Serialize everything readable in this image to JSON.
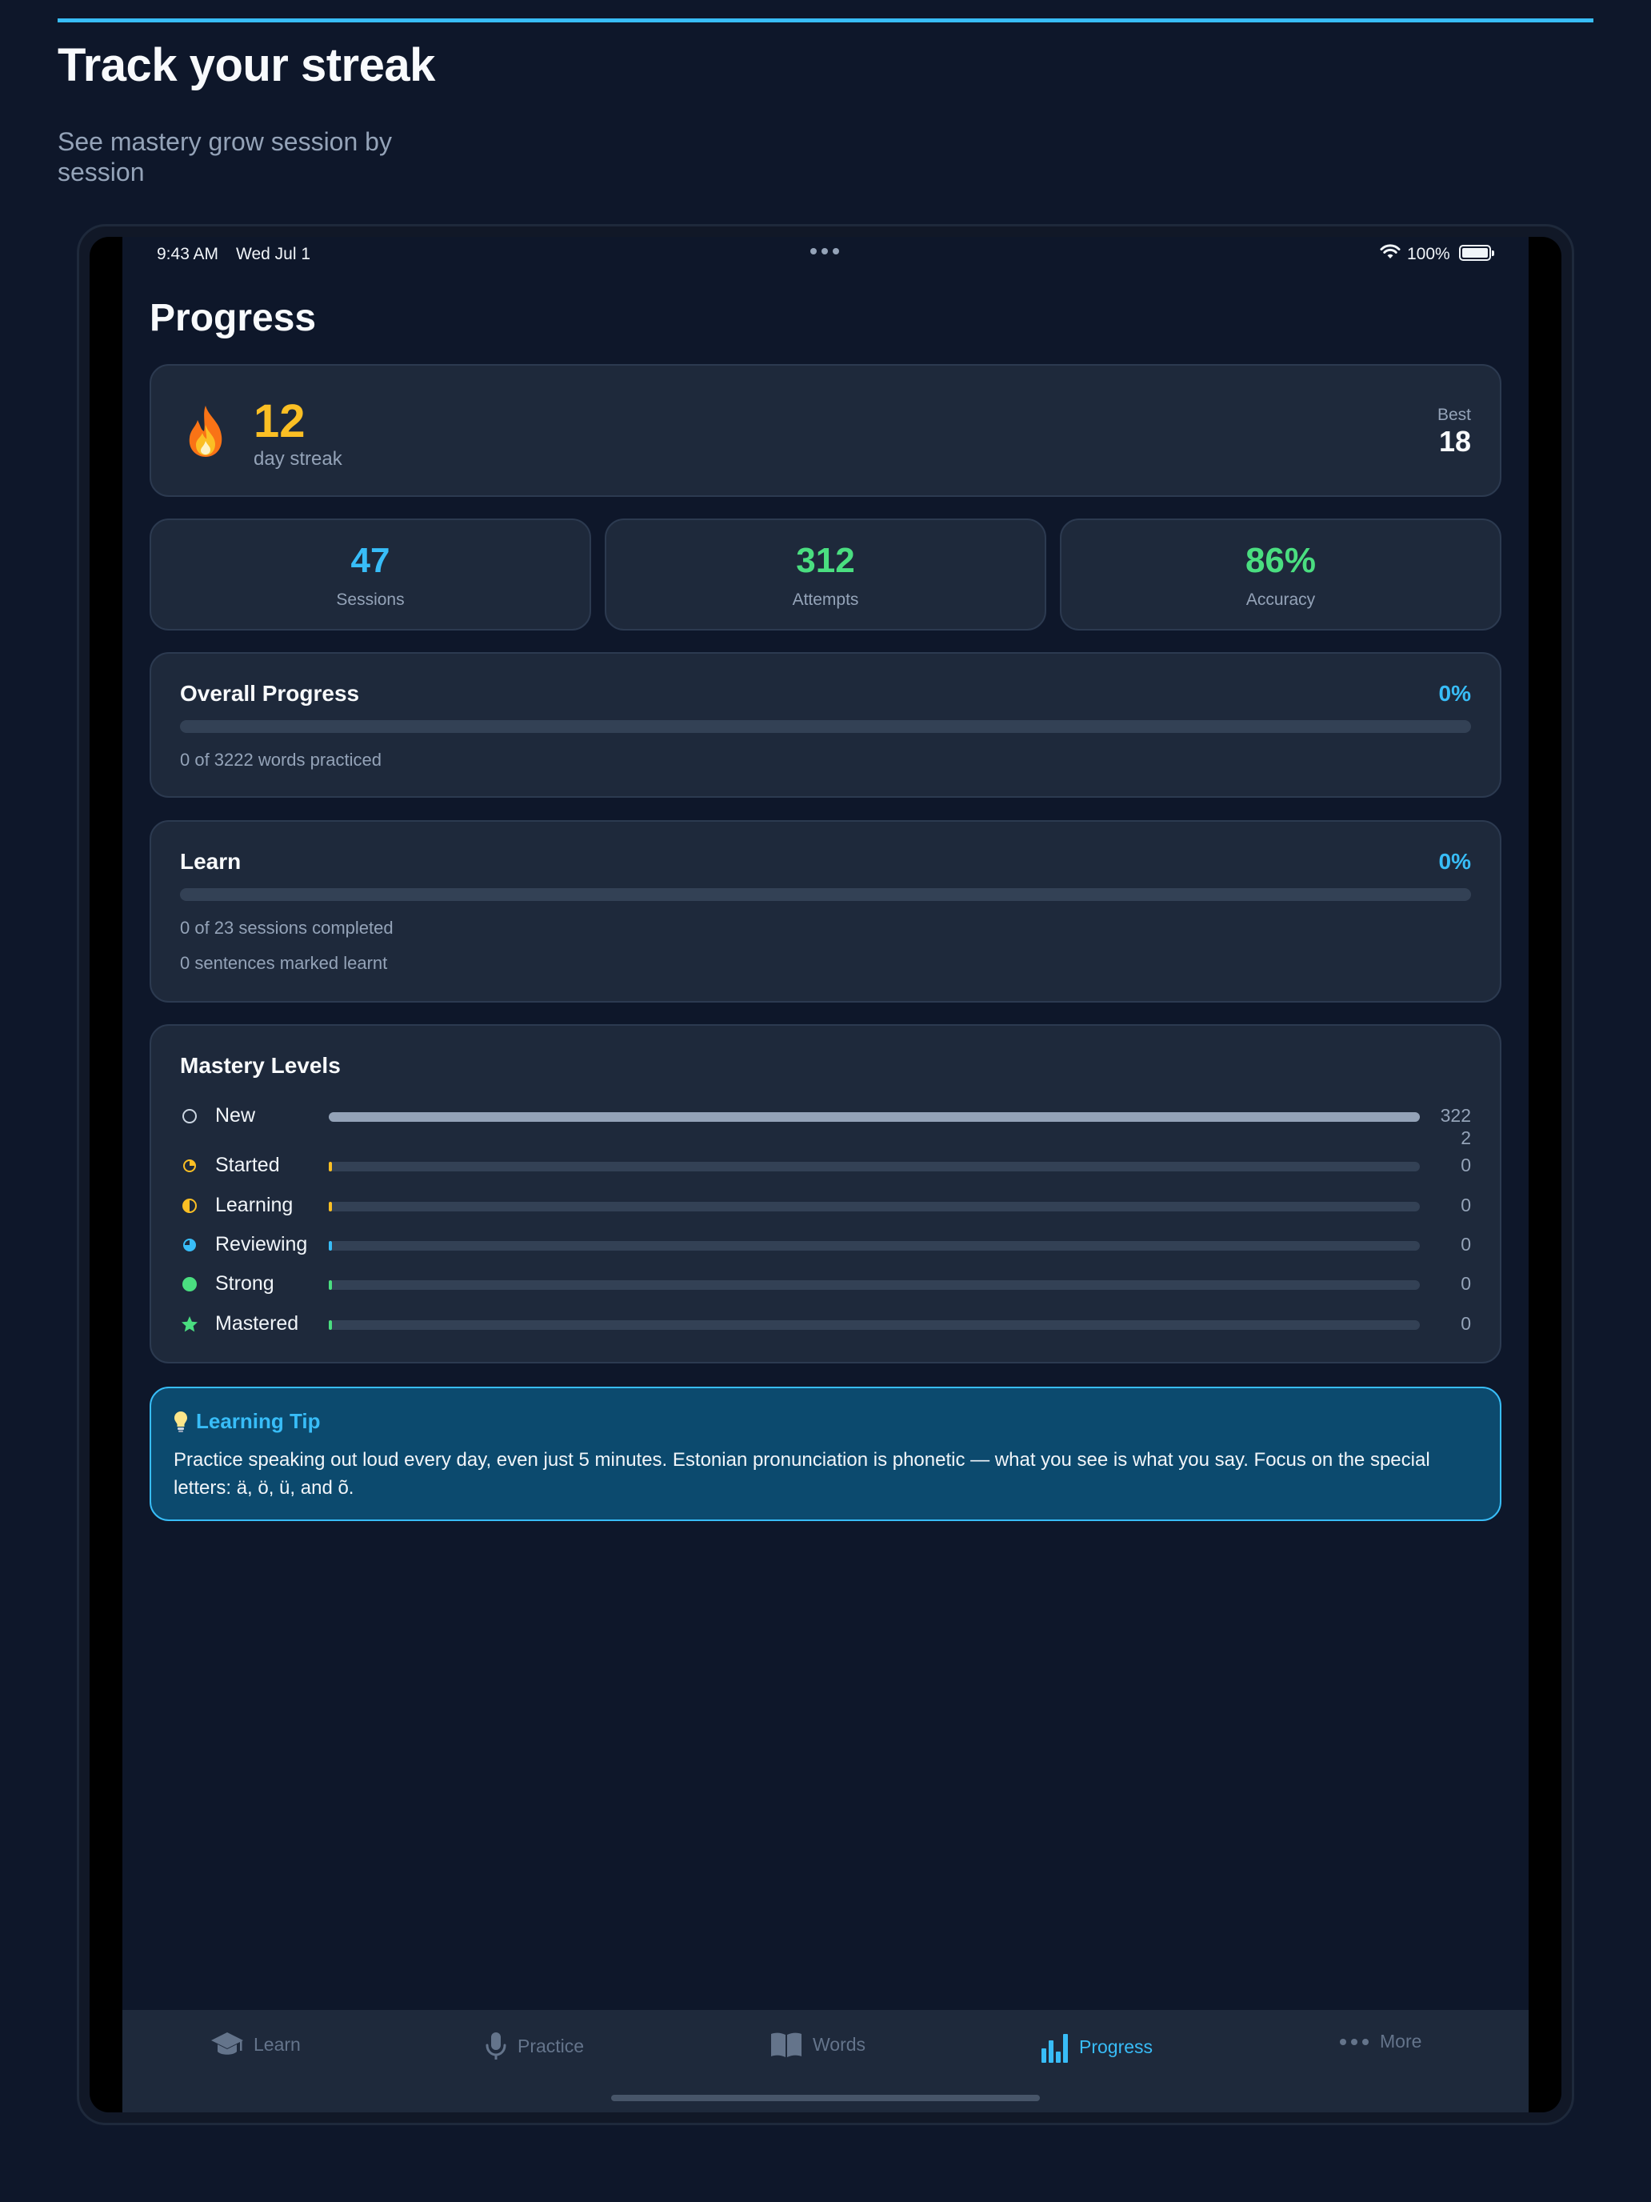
{
  "hero": {
    "title": "Track your streak",
    "subtitle": "See mastery grow session by session"
  },
  "status_bar": {
    "time": "9:43 AM",
    "date": "Wed Jul 1",
    "battery": "100%"
  },
  "page": {
    "title": "Progress"
  },
  "streak": {
    "count": "12",
    "label": "day streak",
    "best_label": "Best",
    "best_value": "18"
  },
  "stats": [
    {
      "value": "47",
      "label": "Sessions",
      "color": "#38bdf8"
    },
    {
      "value": "312",
      "label": "Attempts",
      "color": "#4ade80"
    },
    {
      "value": "86%",
      "label": "Accuracy",
      "color": "#4ade80"
    }
  ],
  "overall": {
    "title": "Overall Progress",
    "percent": "0%",
    "detail": "0 of 3222 words practiced"
  },
  "learn": {
    "title": "Learn",
    "percent": "0%",
    "detail_sessions": "0 of 23 sessions completed",
    "detail_sentences": "0 sentences marked learnt"
  },
  "mastery": {
    "title": "Mastery Levels",
    "levels": [
      {
        "label": "New",
        "count": "3222",
        "fraction": 1.0,
        "color": "#94a3b8",
        "icon": "empty-circle-icon"
      },
      {
        "label": "Started",
        "count": "0",
        "fraction": 0,
        "color": "#fbbf24",
        "icon": "quarter-circle-icon"
      },
      {
        "label": "Learning",
        "count": "0",
        "fraction": 0,
        "color": "#fbbf24",
        "icon": "half-circle-icon"
      },
      {
        "label": "Reviewing",
        "count": "0",
        "fraction": 0,
        "color": "#38bdf8",
        "icon": "three-quarter-circle-icon"
      },
      {
        "label": "Strong",
        "count": "0",
        "fraction": 0,
        "color": "#4ade80",
        "icon": "full-circle-icon"
      },
      {
        "label": "Mastered",
        "count": "0",
        "fraction": 0,
        "color": "#4ade80",
        "icon": "star-icon"
      }
    ]
  },
  "tip": {
    "title": "Learning Tip",
    "body": "Practice speaking out loud every day, even just 5 minutes. Estonian pronunciation is phonetic — what you see is what you say. Focus on the special letters: ä, ö, ü, and õ."
  },
  "tabs": [
    {
      "label": "Learn",
      "icon": "graduation-cap-icon",
      "active": false
    },
    {
      "label": "Practice",
      "icon": "microphone-icon",
      "active": false
    },
    {
      "label": "Words",
      "icon": "book-icon",
      "active": false
    },
    {
      "label": "Progress",
      "icon": "bar-chart-icon",
      "active": true
    },
    {
      "label": "More",
      "icon": "ellipsis-icon",
      "active": false
    }
  ],
  "colors": {
    "accent": "#38bdf8",
    "streak": "#fbbf24",
    "success": "#4ade80",
    "background": "#0e172a",
    "card": "#1e293b"
  }
}
